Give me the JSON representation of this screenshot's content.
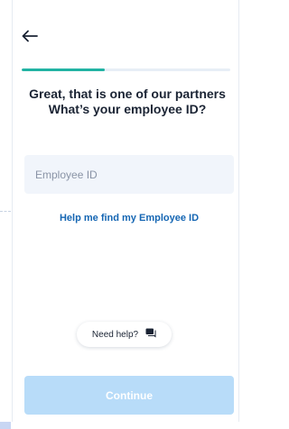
{
  "header": {
    "back_icon": "arrow-left-icon"
  },
  "progress": {
    "value": 0.4,
    "fill_color": "#22b3a3",
    "track_color": "#e7eef6"
  },
  "title": {
    "line1": "Great, that is one of our partners",
    "line2": "What’s your employee ID?"
  },
  "employee_id": {
    "value": "",
    "placeholder": "Employee ID"
  },
  "help_link": {
    "label": "Help me find my Employee ID",
    "color": "#1566b3"
  },
  "need_help": {
    "label": "Need help?",
    "icon": "chat-icon"
  },
  "continue_button": {
    "label": "Continue",
    "disabled": true,
    "color": "#b8dcf9"
  }
}
